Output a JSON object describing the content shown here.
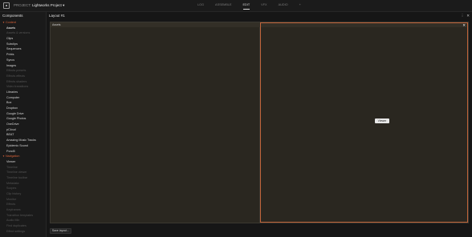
{
  "topbar": {
    "project_label": "PROJECT:",
    "project_name": "Lightworks Project",
    "dropdown_glyph": "▾",
    "tabs": [
      {
        "label": "LOG",
        "active": false
      },
      {
        "label": "ASSEMBLE",
        "active": false
      },
      {
        "label": "EDIT",
        "active": true
      },
      {
        "label": "VFX",
        "active": false
      },
      {
        "label": "AUDIO",
        "active": false
      },
      {
        "label": "+",
        "active": false
      }
    ]
  },
  "left_panel": {
    "title": "Components",
    "sections": [
      {
        "label": "Content",
        "items": [
          {
            "label": "Assets",
            "enabled": true,
            "selected": true
          },
          {
            "label": "Assets & versions",
            "enabled": false
          },
          {
            "label": "Clips",
            "enabled": true
          },
          {
            "label": "Subclips",
            "enabled": true
          },
          {
            "label": "Sequences",
            "enabled": true
          },
          {
            "label": "Prints",
            "enabled": true
          },
          {
            "label": "Syncs",
            "enabled": true
          },
          {
            "label": "Images",
            "enabled": true
          },
          {
            "label": "Effects presets",
            "enabled": false
          },
          {
            "label": "Effects effects",
            "enabled": false
          },
          {
            "label": "Effects shaders",
            "enabled": false
          },
          {
            "label": "Video transitions",
            "enabled": false
          },
          {
            "label": "Libraries",
            "enabled": true
          },
          {
            "label": "Computer",
            "enabled": true
          },
          {
            "label": "Box",
            "enabled": true
          },
          {
            "label": "Dropbox",
            "enabled": true
          },
          {
            "label": "Google Drive",
            "enabled": true
          },
          {
            "label": "Google Photos",
            "enabled": true
          },
          {
            "label": "OneDrive",
            "enabled": true
          },
          {
            "label": "pCloud",
            "enabled": true
          },
          {
            "label": "BEAT",
            "enabled": true
          },
          {
            "label": "Amazing Music Tracks",
            "enabled": true
          },
          {
            "label": "Epidemic Sound",
            "enabled": true
          },
          {
            "label": "Pond5",
            "enabled": true
          }
        ]
      },
      {
        "label": "Navigation",
        "items": [
          {
            "label": "Viewer",
            "enabled": true
          },
          {
            "label": "Timeline",
            "enabled": false
          },
          {
            "label": "Timeline viewer",
            "enabled": false
          },
          {
            "label": "Timeline toolbar",
            "enabled": false
          },
          {
            "label": "Metadata",
            "enabled": false
          },
          {
            "label": "Scopes",
            "enabled": false
          },
          {
            "label": "Clip history",
            "enabled": false
          },
          {
            "label": "Monitor",
            "enabled": false
          },
          {
            "label": "Effects",
            "enabled": false
          },
          {
            "label": "Keyframes",
            "enabled": false
          },
          {
            "label": "Transition templates",
            "enabled": false
          },
          {
            "label": "Audio Mix",
            "enabled": false
          },
          {
            "label": "Find duplicates",
            "enabled": false
          },
          {
            "label": "Effect settings",
            "enabled": false
          }
        ]
      }
    ]
  },
  "main": {
    "layout_title": "Layout #1",
    "menu_glyph": "⋮",
    "close_glyph": "✕",
    "assets_panel_label": "Assets",
    "viewer_close_glyph": "✕",
    "viewer_button_label": "Viewer",
    "save_button_label": "Save layout..."
  },
  "colors": {
    "accent": "#d9623a",
    "workspace_bg": "#2a2720",
    "selection_border": "#c0643a"
  },
  "icons": [
    "app-menu-icon",
    "more-options-icon",
    "close-icon",
    "caret-down-icon"
  ]
}
